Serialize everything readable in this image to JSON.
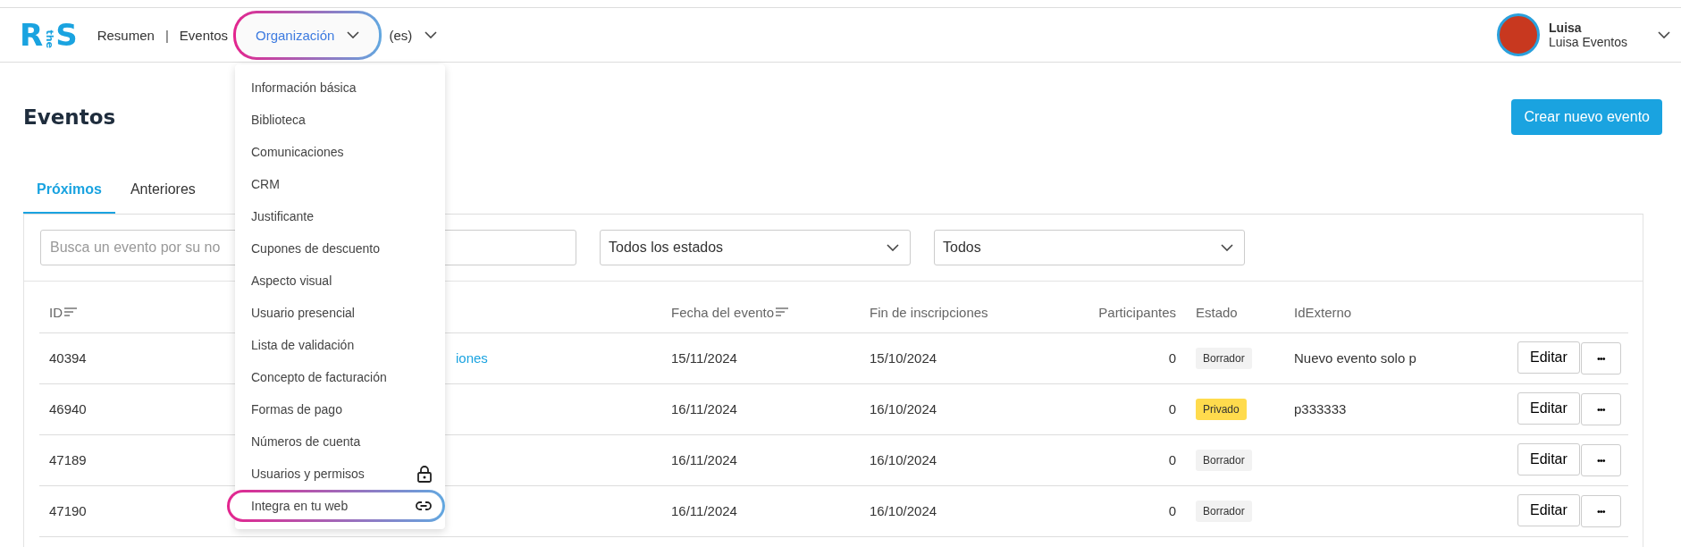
{
  "header": {
    "logo": {
      "left": "R",
      "middle": "the",
      "right": "S"
    },
    "nav": [
      {
        "label": "Resumen",
        "kind": "link",
        "selected": false,
        "highlighted": false,
        "separator_after": "|"
      },
      {
        "label": "Eventos",
        "kind": "link",
        "selected": false,
        "highlighted": false
      },
      {
        "label": "Organización",
        "kind": "dropdown",
        "selected": true,
        "highlighted": true
      },
      {
        "label": "(es)",
        "kind": "dropdown",
        "selected": false,
        "highlighted": false
      }
    ],
    "user": {
      "name": "Luisa",
      "organization": "Luisa Eventos"
    }
  },
  "organization_menu": [
    {
      "label": "Información básica",
      "kind": "plain",
      "highlighted": false
    },
    {
      "label": "Biblioteca",
      "kind": "plain",
      "highlighted": false
    },
    {
      "label": "Comunicaciones",
      "kind": "plain",
      "highlighted": false
    },
    {
      "label": "CRM",
      "kind": "plain",
      "highlighted": false
    },
    {
      "label": "Justificante",
      "kind": "plain",
      "highlighted": false
    },
    {
      "label": "Cupones de descuento",
      "kind": "plain",
      "highlighted": false
    },
    {
      "label": "Aspecto visual",
      "kind": "plain",
      "highlighted": false
    },
    {
      "label": "Usuario presencial",
      "kind": "plain",
      "highlighted": false
    },
    {
      "label": "Lista de validación",
      "kind": "plain",
      "highlighted": false
    },
    {
      "label": "Concepto de facturación",
      "kind": "plain",
      "highlighted": false
    },
    {
      "label": "Formas de pago",
      "kind": "plain",
      "highlighted": false
    },
    {
      "label": "Números de cuenta",
      "kind": "plain",
      "highlighted": false
    },
    {
      "label": "Usuarios y permisos",
      "kind": "locked",
      "highlighted": false
    },
    {
      "label": "Integra en tu web",
      "kind": "link",
      "highlighted": true
    }
  ],
  "page": {
    "title": "Eventos",
    "create_button": "Crear nuevo evento"
  },
  "tabs": [
    {
      "label": "Próximos",
      "selected": true
    },
    {
      "label": "Anteriores",
      "selected": false
    }
  ],
  "filters": {
    "search": {
      "placeholder": "Busca un evento por su no"
    },
    "status_select": "Todos los estados",
    "type_select": "Todos"
  },
  "table": {
    "columns": [
      {
        "label": "ID",
        "sortable": true
      },
      {
        "label": "Fecha del evento",
        "sortable": true
      },
      {
        "label": "Fin de inscripciones",
        "sortable": false
      },
      {
        "label": "Participantes",
        "sortable": false
      },
      {
        "label": "Estado",
        "sortable": false
      },
      {
        "label": "IdExterno",
        "sortable": false
      }
    ],
    "rows": [
      {
        "id": "40394",
        "name": "iones",
        "event_date": "15/11/2024",
        "registration_end": "15/10/2024",
        "participants": "0",
        "status": {
          "label": "Borrador",
          "color": "#f2f2f2"
        },
        "external_id": "Nuevo evento solo p",
        "edit": "Editar",
        "more": "•••"
      },
      {
        "id": "46940",
        "event_date": "16/11/2024",
        "registration_end": "16/10/2024",
        "participants": "0",
        "status": {
          "label": "Privado",
          "color": "#ffdb4d"
        },
        "external_id": "p333333",
        "edit": "Editar",
        "more": "•••"
      },
      {
        "id": "47189",
        "event_date": "16/11/2024",
        "registration_end": "16/10/2024",
        "participants": "0",
        "status": {
          "label": "Borrador",
          "color": "#f2f2f2"
        },
        "edit": "Editar",
        "more": "•••"
      },
      {
        "id": "47190",
        "event_date": "16/11/2024",
        "registration_end": "16/10/2024",
        "participants": "0",
        "status": {
          "label": "Borrador",
          "color": "#f2f2f2"
        },
        "edit": "Editar",
        "more": "•••"
      }
    ]
  }
}
